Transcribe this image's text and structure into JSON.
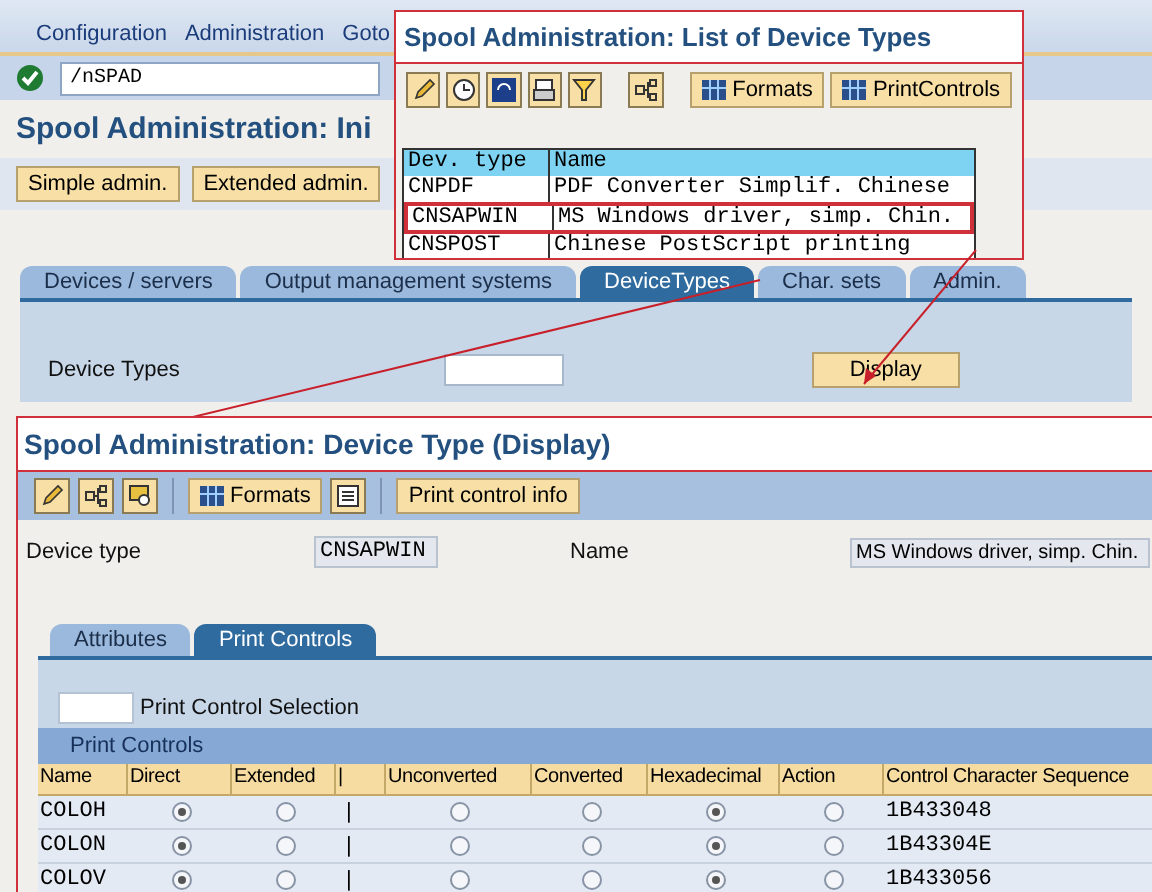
{
  "main_window": {
    "menu": [
      "Configuration",
      "Administration",
      "Goto"
    ],
    "command": "/nSPAD",
    "title": "Spool Administration: Ini",
    "buttons": [
      "Simple admin.",
      "Extended admin."
    ],
    "tabs": [
      {
        "label": "Devices / servers",
        "selected": false
      },
      {
        "label": "Output management systems",
        "selected": false
      },
      {
        "label": "DeviceTypes",
        "selected": true
      },
      {
        "label": "Char. sets",
        "selected": false
      },
      {
        "label": "Admin.",
        "selected": false
      }
    ],
    "field_label": "Device Types",
    "display_button": "Display"
  },
  "list_popup": {
    "title": "Spool Administration: List of Device Types",
    "buttons": [
      "Formats",
      "PrintControls"
    ],
    "columns": [
      "Dev. type",
      "Name"
    ],
    "rows": [
      {
        "type": "CNPDF",
        "name": "PDF Converter Simplif. Chinese",
        "marked": false
      },
      {
        "type": "CNSAPWIN",
        "name": "MS Windows driver, simp. Chin.",
        "marked": true
      },
      {
        "type": "CNSPOST",
        "name": "Chinese PostScript printing",
        "marked": false
      }
    ]
  },
  "detail_window": {
    "title": "Spool Administration: Device Type (Display)",
    "buttons": [
      "Formats",
      "Print control info"
    ],
    "device_type_label": "Device type",
    "device_type": "CNSAPWIN",
    "name_label": "Name",
    "name": "MS Windows driver, simp. Chin.",
    "tabs": [
      {
        "label": "Attributes",
        "selected": false
      },
      {
        "label": "Print Controls",
        "selected": true
      }
    ],
    "selection_label": "Print Control Selection",
    "table_title": "Print Controls",
    "columns": [
      "Name",
      "Direct",
      "Extended",
      "|",
      "Unconverted",
      "Converted",
      "Hexadecimal",
      "Action",
      "Control Character Sequence"
    ],
    "rows": [
      {
        "name": "COLOH",
        "mode": [
          true,
          false
        ],
        "bar": "|",
        "format": [
          false,
          false,
          true,
          false
        ],
        "sequence": "1B433048"
      },
      {
        "name": "COLON",
        "mode": [
          true,
          false
        ],
        "bar": "|",
        "format": [
          false,
          false,
          true,
          false
        ],
        "sequence": "1B43304E"
      },
      {
        "name": "COLOV",
        "mode": [
          true,
          false
        ],
        "bar": "|",
        "format": [
          false,
          false,
          true,
          false
        ],
        "sequence": "1B433056"
      }
    ]
  }
}
